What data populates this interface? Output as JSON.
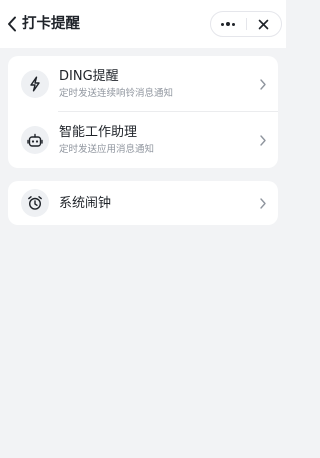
{
  "header": {
    "title": "打卡提醒",
    "back_icon": "chevron-left-icon",
    "more_icon": "more-dots-icon",
    "close_icon": "close-icon"
  },
  "reminders": [
    {
      "title": "DING提醒",
      "subtitle": "定时发送连续响铃消息通知",
      "icon": "lightning-icon"
    },
    {
      "title": "智能工作助理",
      "subtitle": "定时发送应用消息通知",
      "icon": "robot-icon"
    }
  ],
  "alarm": {
    "title": "系统闹钟",
    "icon": "alarm-clock-icon"
  },
  "colors": {
    "background": "#f2f3f5",
    "card": "#ffffff",
    "subtitle": "#8f959e",
    "icon_bg": "#eef0f3"
  }
}
